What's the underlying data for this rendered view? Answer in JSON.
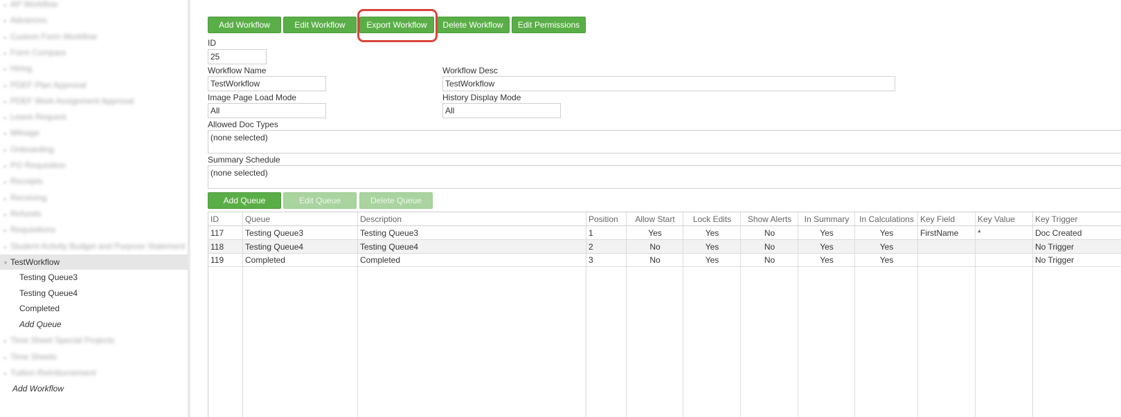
{
  "sidebar": {
    "blurred_items": [
      {
        "label": "AP Workflow",
        "expander": "▸"
      },
      {
        "label": "Advances",
        "expander": "▸"
      },
      {
        "label": "Custom Form Workflow",
        "expander": "▸"
      },
      {
        "label": "Form Compare",
        "expander": "▸"
      },
      {
        "label": "Hiring",
        "expander": "▸"
      },
      {
        "label": "PDEF Plan Approval",
        "expander": "▸"
      },
      {
        "label": "PDEF Work Assignment Approval",
        "expander": "▸"
      },
      {
        "label": "Leave Request",
        "expander": "▸"
      },
      {
        "label": "Mileage",
        "expander": "▸"
      },
      {
        "label": "Onboarding",
        "expander": "▸"
      },
      {
        "label": "PO Requisition",
        "expander": "▸"
      },
      {
        "label": "Receipts",
        "expander": "▸"
      },
      {
        "label": "Receiving",
        "expander": "▸"
      },
      {
        "label": "Refunds",
        "expander": "▸"
      },
      {
        "label": "Requisitions",
        "expander": "▸"
      },
      {
        "label": "Student Activity Budget and Purpose Statement",
        "expander": "▸"
      }
    ],
    "selected": {
      "label": "TestWorkflow",
      "expander": "▾"
    },
    "children": [
      "Testing Queue3",
      "Testing Queue4",
      "Completed"
    ],
    "add_queue_label": "Add Queue",
    "blurred_items_after": [
      {
        "label": "Time Sheet Special Projects",
        "expander": "▸"
      },
      {
        "label": "Time Sheets",
        "expander": "▸"
      },
      {
        "label": "Tuition Reimbursement",
        "expander": "▸"
      }
    ],
    "add_workflow_label": "Add Workflow"
  },
  "toolbar": {
    "add_workflow": "Add Workflow",
    "edit_workflow": "Edit Workflow",
    "export_workflow": "Export Workflow",
    "delete_workflow": "Delete Workflow",
    "edit_permissions": "Edit Permissions"
  },
  "form": {
    "id_label": "ID",
    "id_value": "25",
    "workflow_name_label": "Workflow Name",
    "workflow_name_value": "TestWorkflow",
    "workflow_desc_label": "Workflow Desc",
    "workflow_desc_value": "TestWorkflow",
    "image_page_load_mode_label": "Image Page Load Mode",
    "image_page_load_mode_value": "All",
    "history_display_mode_label": "History Display Mode",
    "history_display_mode_value": "All",
    "allowed_doc_types_label": "Allowed Doc Types",
    "allowed_doc_types_value": "(none selected)",
    "summary_schedule_label": "Summary Schedule",
    "summary_schedule_value": "(none selected)"
  },
  "queue_toolbar": {
    "add_queue": "Add Queue",
    "edit_queue": "Edit Queue",
    "delete_queue": "Delete Queue"
  },
  "grid": {
    "columns": [
      "ID",
      "Queue",
      "Description",
      "Position",
      "Allow Start",
      "Lock Edits",
      "Show Alerts",
      "In Summary",
      "In Calculations",
      "Key Field",
      "Key Value",
      "Key Trigger"
    ],
    "rows": [
      [
        "117",
        "Testing Queue3",
        "Testing Queue3",
        "1",
        "Yes",
        "Yes",
        "No",
        "Yes",
        "Yes",
        "FirstName",
        "*",
        "Doc Created"
      ],
      [
        "118",
        "Testing Queue4",
        "Testing Queue4",
        "2",
        "No",
        "Yes",
        "No",
        "Yes",
        "Yes",
        "",
        "",
        "No Trigger"
      ],
      [
        "119",
        "Completed",
        "Completed",
        "3",
        "No",
        "Yes",
        "No",
        "Yes",
        "Yes",
        "",
        "",
        "No Trigger"
      ]
    ]
  },
  "colors": {
    "button_green": "#5aae47",
    "button_disabled": "#a9d39f",
    "highlight_red": "#d9453a",
    "selected_row": "#e6e6e6"
  }
}
